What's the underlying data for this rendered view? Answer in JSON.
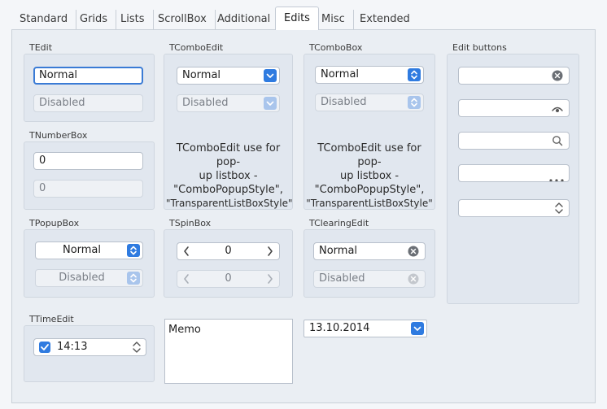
{
  "tabs": [
    {
      "label": "Standard"
    },
    {
      "label": "Grids"
    },
    {
      "label": "Lists"
    },
    {
      "label": "ScrollBox"
    },
    {
      "label": "Additional"
    },
    {
      "label": "Edits"
    },
    {
      "label": "Misc"
    },
    {
      "label": "Extended"
    }
  ],
  "active_tab": "Edits",
  "colors": {
    "accent": "#2f7be0",
    "page": "#eaeef3",
    "group": "#e1e7ef"
  },
  "tedit": {
    "title": "TEdit",
    "normal": "Normal",
    "disabled": "Disabled"
  },
  "tnumberbox": {
    "title": "TNumberBox",
    "value1": "0",
    "value2": "0"
  },
  "tpopupbox": {
    "title": "TPopupBox",
    "normal": "Normal",
    "disabled": "Disabled"
  },
  "ttimeedit": {
    "title": "TTimeEdit",
    "time": "14:13",
    "checked": true
  },
  "tcomboedit": {
    "title": "TComboEdit",
    "normal": "Normal",
    "disabled": "Disabled",
    "desc_line1": "TComboEdit use for pop-",
    "desc_line2": "up listbox -",
    "desc_line3": "\"ComboPopupStyle\",",
    "desc_line4": "\"TransparentListBoxStyle\""
  },
  "tspinbox": {
    "title": "TSpinBox",
    "value1": "0",
    "value2": "0"
  },
  "memo": {
    "text": "Memo"
  },
  "tcombobox": {
    "title": "TComboBox",
    "normal": "Normal",
    "disabled": "Disabled",
    "desc_line1": "TComboEdit use for pop-",
    "desc_line2": "up listbox -",
    "desc_line3": "\"ComboPopupStyle\",",
    "desc_line4": "\"TransparentListBoxStyle\""
  },
  "tclearingedit": {
    "title": "TClearingEdit",
    "normal": "Normal",
    "disabled": "Disabled"
  },
  "dateedit": {
    "value": "13.10.2014"
  },
  "editbuttons": {
    "title": "Edit buttons",
    "icons": [
      "clear-icon",
      "password-eye-icon",
      "search-icon",
      "ellipsis-icon",
      "spin-updown-icon"
    ]
  }
}
